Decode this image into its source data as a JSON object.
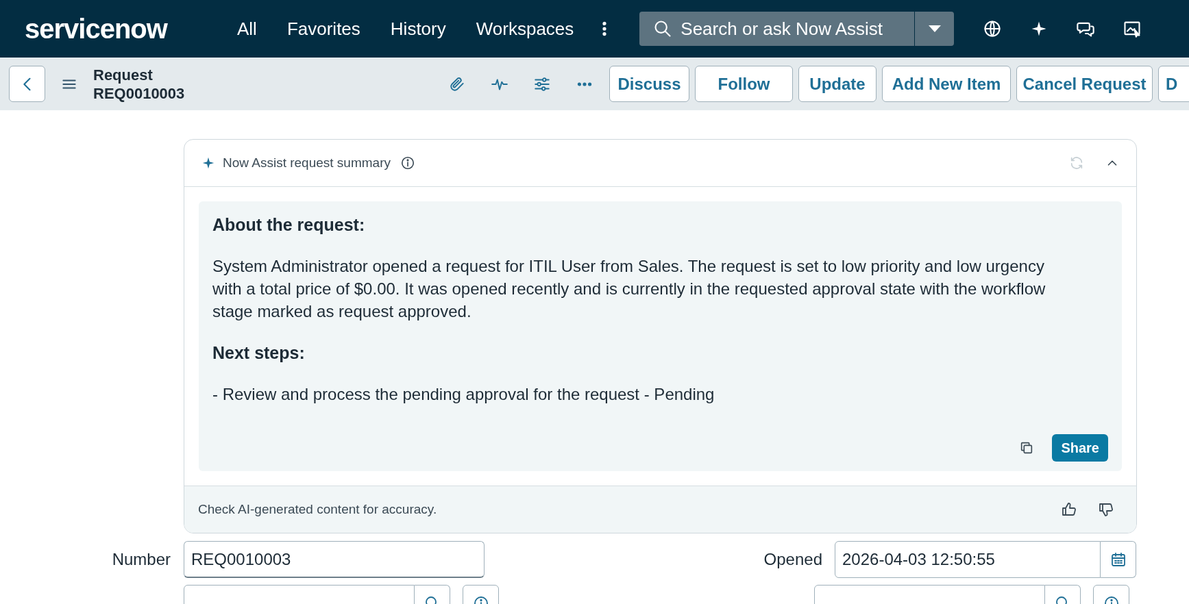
{
  "header": {
    "logo": "servicenow",
    "nav": [
      "All",
      "Favorites",
      "History",
      "Workspaces"
    ],
    "search": {
      "placeholder": "Search or ask Now Assist"
    }
  },
  "toolbar": {
    "title": "Request",
    "number": "REQ0010003",
    "buttons": [
      "Discuss",
      "Follow",
      "Update",
      "Add New Item",
      "Cancel Request",
      "D"
    ]
  },
  "summary": {
    "title": "Now Assist request summary",
    "sections": [
      {
        "heading": "About the request:",
        "text": "System Administrator opened a request for ITIL User from Sales. The request is set to low priority and low urgency with a total price of $0.00. It was opened recently and is currently in the requested approval state with the workflow stage marked as request approved."
      },
      {
        "heading": "Next steps:",
        "text": "- Review and process the pending approval for the request - Pending"
      }
    ],
    "share_button": "Share",
    "footer_note": "Check AI-generated content for accuracy."
  },
  "form": {
    "rows": [
      [
        {
          "label": "Number",
          "value": "REQ0010003",
          "kind": "text"
        },
        {
          "label": "Opened",
          "value": "2026-04-03 12:50:55",
          "kind": "date"
        }
      ],
      [
        {
          "kind": "reference"
        },
        {
          "kind": "reference"
        }
      ]
    ]
  }
}
